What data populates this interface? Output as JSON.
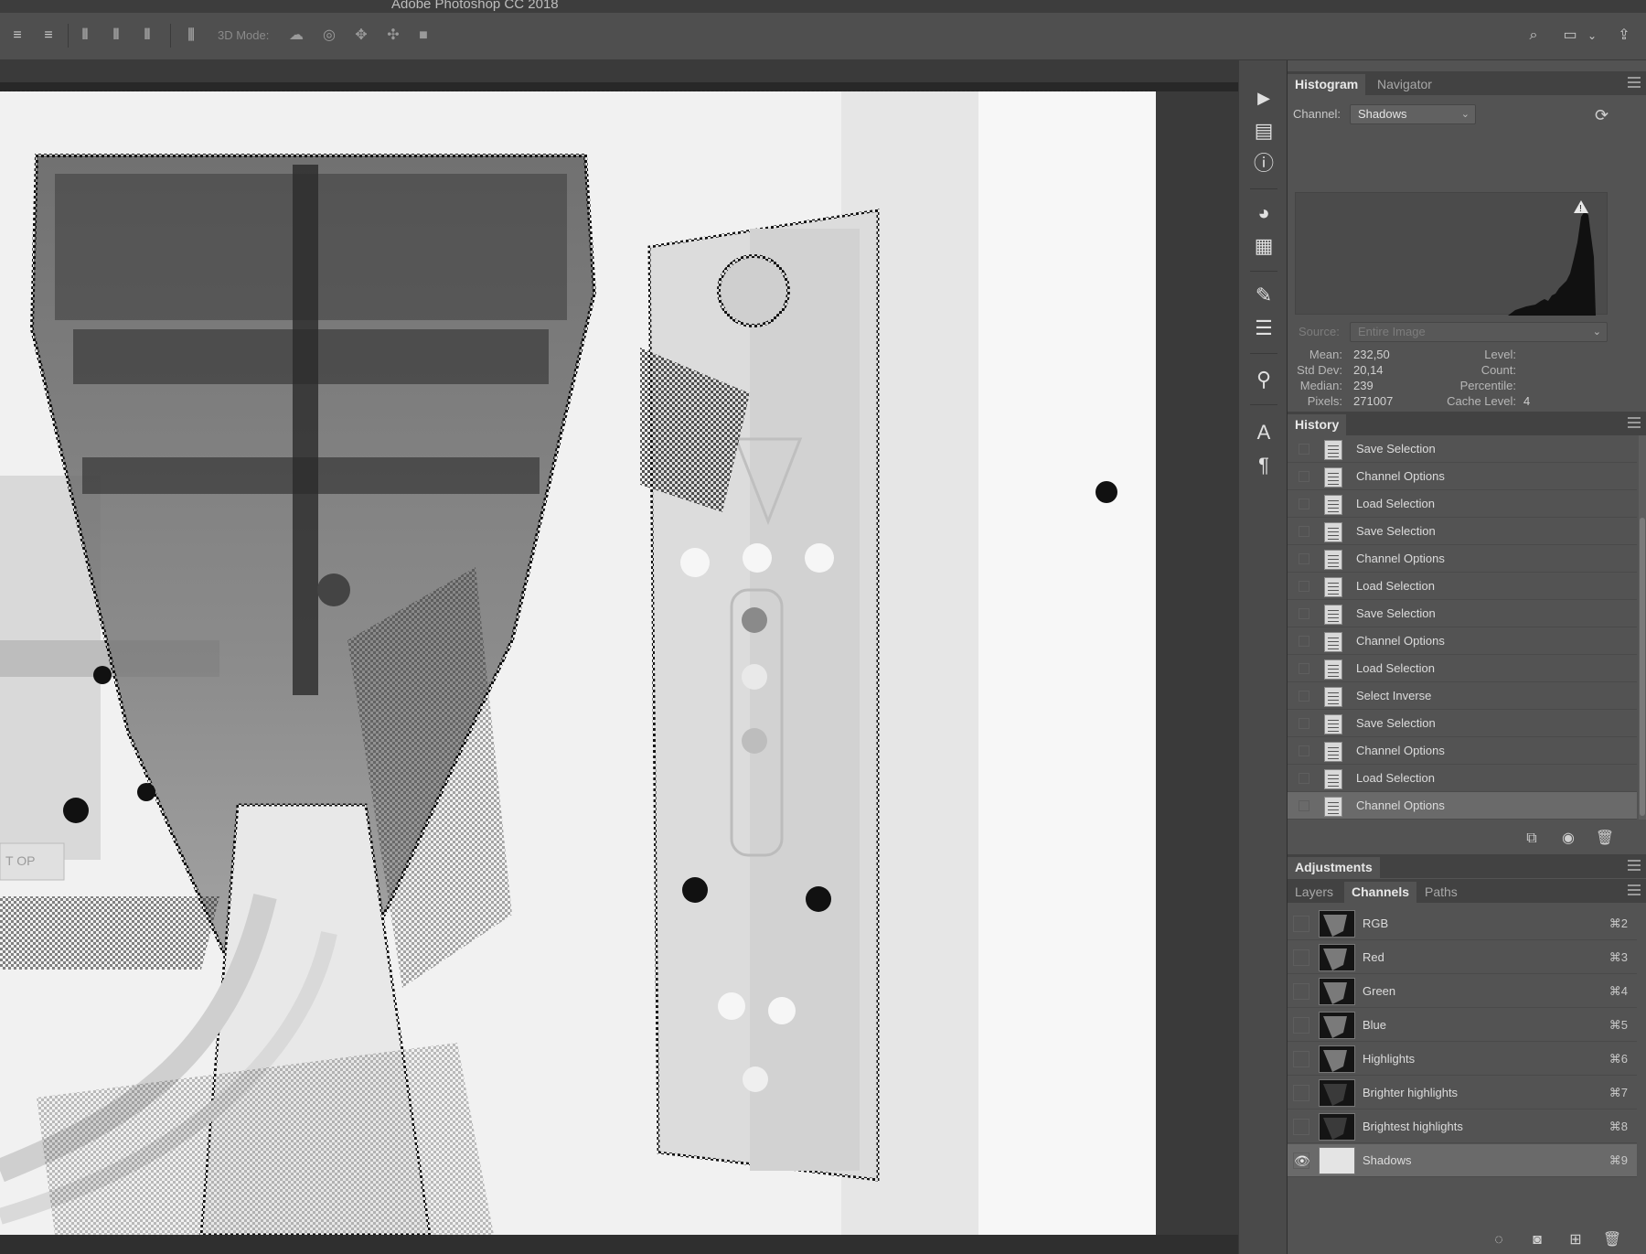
{
  "app": {
    "title": "Adobe Photoshop CC 2018"
  },
  "options_bar": {
    "mode_label": "3D Mode:",
    "align_icons": [
      "align-top-icon",
      "align-vcenter-icon",
      "align-bottom-icon",
      "align-left-icon",
      "align-hcenter-icon",
      "align-right-icon",
      "distribute-icon"
    ],
    "mode_icons": [
      "orbit-3d-icon",
      "roll-3d-icon",
      "pan-3d-icon",
      "slide-3d-icon",
      "scale-3d-icon"
    ],
    "right_icons": [
      "search-icon",
      "workspace-icon",
      "share-icon"
    ]
  },
  "toolstrip": {
    "icons": [
      "play-icon",
      "properties-icon",
      "info-icon",
      "color-icon",
      "swatches-icon",
      "brush-icon",
      "adjust-icon",
      "clone-source-icon",
      "character-icon",
      "paragraph-icon"
    ]
  },
  "histogram": {
    "tabs": [
      "Histogram",
      "Navigator"
    ],
    "channel_label": "Channel:",
    "channel_value": "Shadows",
    "source_label": "Source:",
    "source_value": "Entire Image",
    "stats": {
      "mean_label": "Mean:",
      "mean": "232,50",
      "stddev_label": "Std Dev:",
      "stddev": "20,14",
      "median_label": "Median:",
      "median": "239",
      "pixels_label": "Pixels:",
      "pixels": "271007",
      "level_label": "Level:",
      "level": "",
      "count_label": "Count:",
      "count": "",
      "percentile_label": "Percentile:",
      "percentile": "",
      "cache_label": "Cache Level:",
      "cache": "4"
    }
  },
  "history": {
    "tab": "History",
    "items": [
      "Save Selection",
      "Channel Options",
      "Load Selection",
      "Save Selection",
      "Channel Options",
      "Load Selection",
      "Save Selection",
      "Channel Options",
      "Load Selection",
      "Select Inverse",
      "Save Selection",
      "Channel Options",
      "Load Selection",
      "Channel Options"
    ],
    "selected_index": 13
  },
  "adjustments": {
    "tab": "Adjustments"
  },
  "channels_panel": {
    "tabs": [
      "Layers",
      "Channels",
      "Paths"
    ],
    "active_tab": "Channels",
    "channels": [
      {
        "name": "RGB",
        "shortcut": "⌘2"
      },
      {
        "name": "Red",
        "shortcut": "⌘3"
      },
      {
        "name": "Green",
        "shortcut": "⌘4"
      },
      {
        "name": "Blue",
        "shortcut": "⌘5"
      },
      {
        "name": "Highlights",
        "shortcut": "⌘6"
      },
      {
        "name": "Brighter highlights",
        "shortcut": "⌘7"
      },
      {
        "name": "Brightest highlights",
        "shortcut": "⌘8"
      },
      {
        "name": "Shadows",
        "shortcut": "⌘9"
      }
    ],
    "selected_index": 7
  },
  "canvas_text": {
    "sign": "T OP"
  }
}
